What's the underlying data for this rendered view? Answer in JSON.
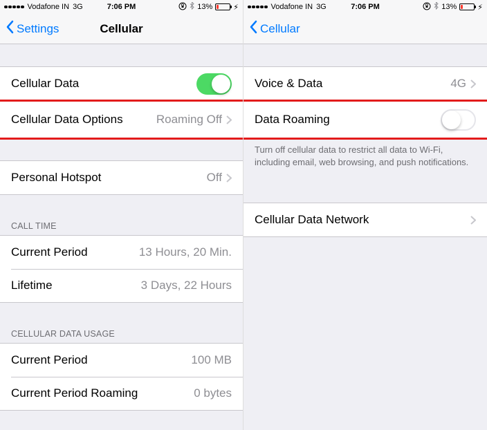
{
  "status": {
    "carrier": "Vodafone IN",
    "network": "3G",
    "time": "7:06 PM",
    "battery_pct": "13%"
  },
  "left": {
    "back_label": "Settings",
    "title": "Cellular",
    "cellular_data_label": "Cellular Data",
    "cellular_data_on": true,
    "options_label": "Cellular Data Options",
    "options_value": "Roaming Off",
    "hotspot_label": "Personal Hotspot",
    "hotspot_value": "Off",
    "calltime_header": "CALL TIME",
    "current_period_label": "Current Period",
    "current_period_value": "13 Hours, 20 Min.",
    "lifetime_label": "Lifetime",
    "lifetime_value": "3 Days, 22 Hours",
    "usage_header": "CELLULAR DATA USAGE",
    "usage_period_label": "Current Period",
    "usage_period_value": "100 MB",
    "usage_roaming_label": "Current Period Roaming",
    "usage_roaming_value": "0 bytes"
  },
  "right": {
    "back_label": "Cellular",
    "voice_label": "Voice & Data",
    "voice_value": "4G",
    "roaming_label": "Data Roaming",
    "roaming_on": false,
    "footer_text": "Turn off cellular data to restrict all data to Wi-Fi, including email, web browsing, and push notifications.",
    "network_label": "Cellular Data Network"
  }
}
